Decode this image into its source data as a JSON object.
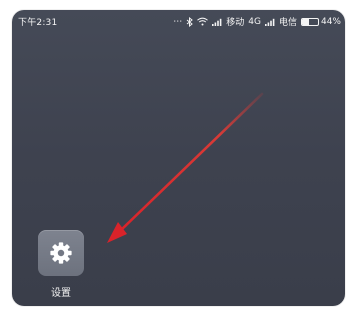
{
  "status_bar": {
    "time": "下午2:31",
    "carrier1": "移动",
    "network": "4G",
    "carrier2": "电信",
    "battery": "44%",
    "battery_level": 0.44
  },
  "app": {
    "label": "设置"
  },
  "colors": {
    "arrow": "#e03a35"
  }
}
